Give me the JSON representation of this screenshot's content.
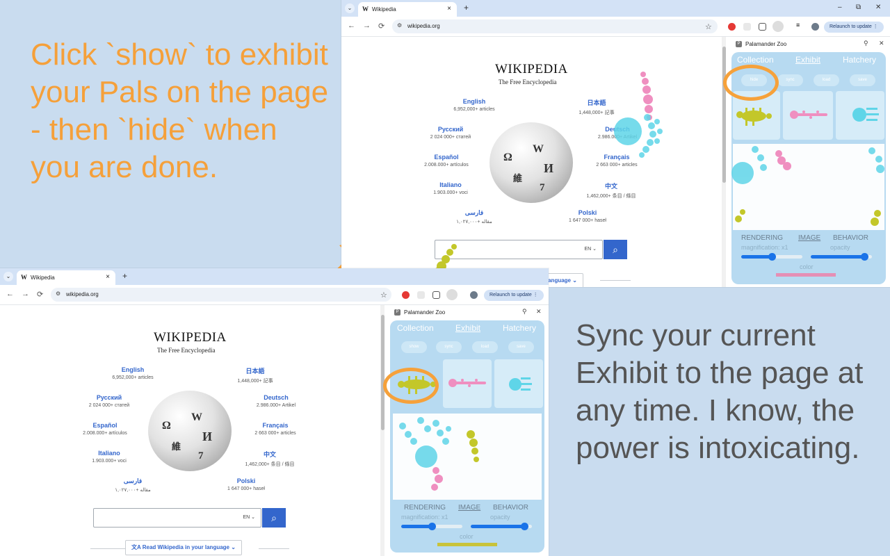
{
  "captions": {
    "top": "Click `show` to exhibit your Pals on the page - then `hide` when you are done.",
    "bottom": "Sync your current Exhibit to the page at any time. I know, the power is intoxicating."
  },
  "browser": {
    "tab_title": "Wikipedia",
    "tab_favicon": "W",
    "tab_close": "×",
    "new_tab": "+",
    "tab_dropdown": "⌄",
    "url": "wikipedia.org",
    "relaunch_label": "Relaunch to update",
    "window_controls": {
      "minimize": "–",
      "restore": "⧉",
      "close": "✕"
    },
    "nav": {
      "back": "←",
      "forward": "→",
      "reload": "⟳",
      "star": "☆",
      "menu": "⋮"
    }
  },
  "wikipedia": {
    "title": "WIKIPEDIA",
    "subtitle": "The Free Encyclopedia",
    "languages": [
      {
        "name": "English",
        "count": "6,952,000+ articles"
      },
      {
        "name": "日本語",
        "count": "1,448,000+ 記事"
      },
      {
        "name": "Русский",
        "count": "2 024 000+ статей"
      },
      {
        "name": "Deutsch",
        "count": "2.986.000+ Artikel"
      },
      {
        "name": "Español",
        "count": "2.008.000+ artículos"
      },
      {
        "name": "Français",
        "count": "2 663 000+ articles"
      },
      {
        "name": "Italiano",
        "count": "1.903.000+ voci"
      },
      {
        "name": "中文",
        "count": "1,462,000+ 条目 / 條目"
      },
      {
        "name": "فارسی",
        "count": "۱,۰۲۷,۰۰۰+ مقاله"
      },
      {
        "name": "Polski",
        "count": "1 647 000+ haseł"
      }
    ],
    "search_lang": "EN ⌄",
    "read_button": "Read Wikipedia in your language"
  },
  "panel": {
    "title": "Palamander Zoo",
    "tabs": [
      "Collection",
      "Exhibit",
      "Hatchery"
    ],
    "active_tab": "Exhibit",
    "buttons_top": [
      "hide",
      "sync",
      "load",
      "save"
    ],
    "buttons_bottom": [
      "show",
      "sync",
      "load",
      "save"
    ],
    "footer_tabs": [
      "RENDERING",
      "IMAGE",
      "BEHAVIOR"
    ],
    "active_footer": "IMAGE",
    "magnification_label": "magnification: x1",
    "opacity_label": "opacity",
    "color_label": "color",
    "top_color": "#e58fb5",
    "bottom_color": "#c8c33a",
    "magnification_value": 0.5,
    "opacity_value": 0.87
  },
  "colors": {
    "accent_orange": "#f6a13a",
    "panel_blue": "#b7daf1",
    "pal_green": "#c3c72a",
    "pal_pink": "#ef8fc0",
    "pal_cyan": "#5fd5e8",
    "wiki_link": "#3366cc"
  }
}
